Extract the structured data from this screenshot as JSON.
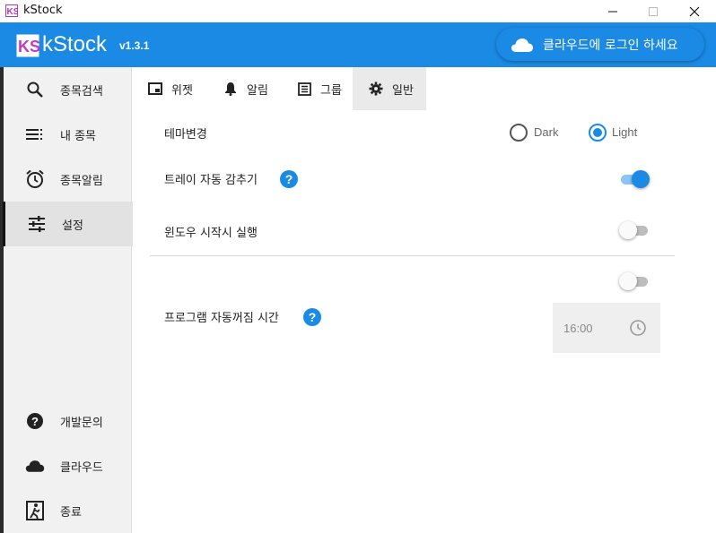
{
  "window": {
    "title": "kStock"
  },
  "app": {
    "name": "kStock",
    "version": "v1.3.1",
    "cloud_login_label": "클라우드에 로그인 하세요",
    "accent_color": "#1b8ae4"
  },
  "sidebar": {
    "items": [
      {
        "label": "종목검색",
        "icon": "search-icon",
        "active": false
      },
      {
        "label": "내 종목",
        "icon": "list-icon",
        "active": false
      },
      {
        "label": "종목알림",
        "icon": "alarm-clock-icon",
        "active": false
      },
      {
        "label": "설정",
        "icon": "sliders-icon",
        "active": true
      }
    ],
    "bottom_items": [
      {
        "label": "개발문의",
        "icon": "help-circle-icon"
      },
      {
        "label": "클라우드",
        "icon": "cloud-icon"
      },
      {
        "label": "종료",
        "icon": "exit-icon"
      }
    ]
  },
  "tabs": [
    {
      "label": "위젯",
      "icon": "widget-icon",
      "active": false
    },
    {
      "label": "알림",
      "icon": "bell-icon",
      "active": false
    },
    {
      "label": "그룹",
      "icon": "group-list-icon",
      "active": false
    },
    {
      "label": "일반",
      "icon": "gear-icon",
      "active": true
    }
  ],
  "settings": {
    "theme": {
      "label": "테마변경",
      "options": [
        "Dark",
        "Light"
      ],
      "selected": "Light"
    },
    "tray_hide": {
      "label": "트레이 자동 감추기",
      "help": "?",
      "enabled": true
    },
    "startup": {
      "label": "윈도우 시작시 실행",
      "enabled": false
    },
    "auto_off": {
      "label": "프로그램 자동꺼짐 시간",
      "help": "?",
      "enabled": false,
      "time": "16:00"
    }
  }
}
